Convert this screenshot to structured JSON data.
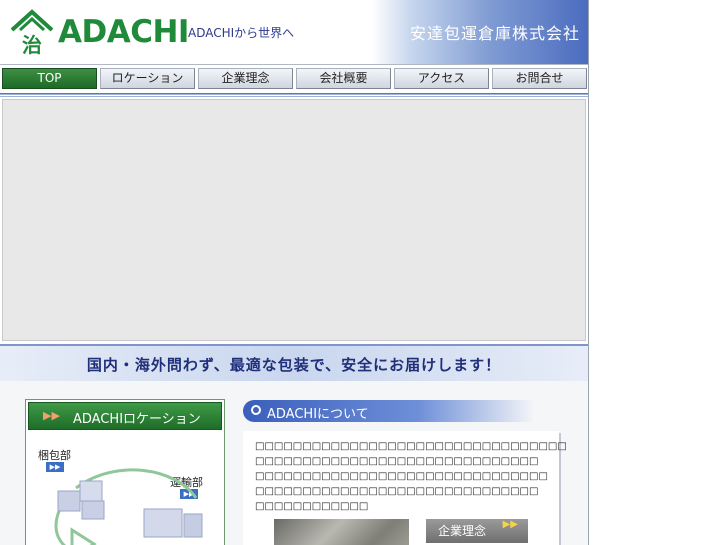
{
  "header": {
    "logo_text": "ADACHI",
    "tagline": "ADACHIから世界へ",
    "company_name": "安達包運倉庫株式会社"
  },
  "nav": {
    "items": [
      {
        "label": "TOP",
        "active": true
      },
      {
        "label": "ロケーション",
        "active": false
      },
      {
        "label": "企業理念",
        "active": false
      },
      {
        "label": "会社概要",
        "active": false
      },
      {
        "label": "アクセス",
        "active": false
      },
      {
        "label": "お問合せ",
        "active": false
      }
    ]
  },
  "slogan": "国内・海外問わず、最適な包装で、安全にお届けします！",
  "location": {
    "title": "ADACHIロケーション",
    "arrows": "▶▶",
    "packing_label": "梱包部",
    "transport_label": "運輸部"
  },
  "about": {
    "title": "ADACHIについて",
    "lines": [
      "□□□□□□□□□□□□□□□□□□□□□□□□□□□□□□□□□",
      "□□□□□□□□□□□□□□□□□□□□□□□□□□□□□□",
      "□□□□□□□□□□□□□□□□□□□□□□□□□□□□□□□",
      "□□□□□□□□□□□□□□□□□□□□□□□□□□□□□□",
      "□□□□□□□□□□□□"
    ],
    "button_label": "企業理念",
    "button_arrows": "▶▶"
  },
  "colors": {
    "brand_green": "#1f8a3a",
    "brand_blue": "#3a5fbc",
    "slogan_text": "#1f2f7a"
  }
}
